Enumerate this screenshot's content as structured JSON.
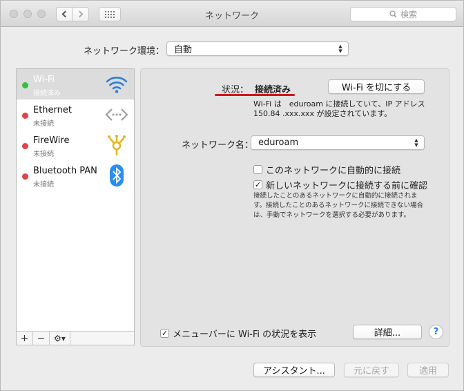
{
  "window": {
    "title": "ネットワーク"
  },
  "search": {
    "placeholder": "検索",
    "icon": "magnifier-icon"
  },
  "location": {
    "label": "ネットワーク環境：",
    "value": "自動"
  },
  "services": [
    {
      "name": "Wi-Fi",
      "status": "接続済み",
      "status_color": "#34c03c",
      "icon": "wifi-icon",
      "selected": true
    },
    {
      "name": "Ethernet",
      "status": "未接続",
      "status_color": "#e0444a",
      "icon": "ethernet-icon"
    },
    {
      "name": "FireWire",
      "status": "未接続",
      "status_color": "#e0444a",
      "icon": "firewire-icon"
    },
    {
      "name": "Bluetooth PAN",
      "status": "未接続",
      "status_color": "#e0444a",
      "icon": "bluetooth-icon"
    }
  ],
  "sidebar_tools": {
    "add": "+",
    "remove": "−",
    "gear": "⚙︎▾"
  },
  "detail": {
    "status_label": "状況：",
    "status_value": "接続済み",
    "toggle_button": "Wi-Fi を切にする",
    "description_line1": "Wi-Fi は　eduroam  に接続していて、IP アドレス",
    "description_line2": "150.84 .xxx.xxx  が設定されています。",
    "network_name_label": "ネットワーク名：",
    "network_name_value": "eduroam",
    "auto_join_label": "このネットワークに自動的に接続",
    "auto_join_checked": false,
    "ask_join_label": "新しいネットワークに接続する前に確認",
    "ask_join_checked": true,
    "help_text": "接続したことのあるネットワークに自動的に接続されます。接続したことのあるネットワークに接続できない場合は、手動でネットワークを選択する必要があります。",
    "menubar_label": "メニューバーに Wi-Fi の状況を表示",
    "menubar_checked": true,
    "advanced_button": "詳細...",
    "help_button": "?"
  },
  "footer": {
    "assistant_button": "アシスタント...",
    "revert_button": "元に戻す",
    "apply_button": "適用"
  },
  "colors": {
    "accent": "#d0161d",
    "selected_row": "#dcdcdc"
  }
}
